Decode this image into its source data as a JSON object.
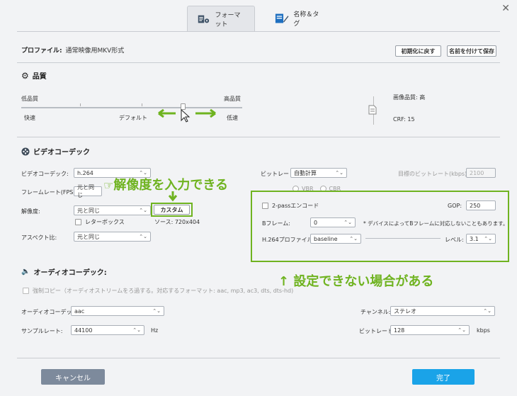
{
  "tabs": [
    {
      "label": "フォーマット",
      "icon": "format-settings-icon"
    },
    {
      "label": "名称＆タグ",
      "icon": "edit-tag-icon"
    }
  ],
  "profile": {
    "label": "プロファイル:",
    "value": "通常映像用MKV形式"
  },
  "buttons": {
    "reset": "初期化に戻す",
    "save_as": "名前を付けて保存",
    "cancel": "キャンセル",
    "ok": "完了"
  },
  "quality": {
    "title": "品質",
    "low": "低品質",
    "high": "高品質",
    "fast": "快速",
    "default": "デフォルト",
    "slow": "低速",
    "image_quality": "画像品質: 高",
    "crf": "CRF: 15"
  },
  "video": {
    "title": "ビデオコーデック",
    "codec_label": "ビデオコーデック:",
    "codec_value": "h.264",
    "fps_label": "フレームレート(FPS):",
    "fps_value": "元と同じ",
    "resolution_label": "解像度:",
    "resolution_value": "元と同じ",
    "custom_button": "カスタム",
    "letterbox": "レターボックス",
    "source": "ソース: 720x404",
    "aspect_label": "アスペクト比:",
    "aspect_value": "元と同じ",
    "bitrate_label": "ビットレート:",
    "bitrate_value": "自動計算",
    "target_bitrate_label": "目標のビットレート(kbps):",
    "target_bitrate_value": "2100",
    "vbr": "VBR",
    "cbr": "CBR",
    "twopass": "2-passエンコード",
    "gop_label": "GOP:",
    "gop_value": "250",
    "bframe_label": "Bフレーム:",
    "bframe_value": "0",
    "bframe_note": "* デバイスによってBフレームに対応しないこともあります。",
    "profile_label": "H.264プロファイル:",
    "profile_value": "baseline",
    "level_label": "レベル:",
    "level_value": "3.1"
  },
  "audio": {
    "title": "オーディオコーデック:",
    "force_copy": "強制コピー（オーディオストリームをろ過する。対応するフォーマット: aac, mp3, ac3, dts, dts-hd)",
    "codec_label": "オーディオコーデック:",
    "codec_value": "aac",
    "channel_label": "チャンネル:",
    "channel_value": "ステレオ",
    "samplerate_label": "サンプルレート:",
    "samplerate_value": "44100",
    "samplerate_unit": "Hz",
    "bitrate_label": "ビットレート:",
    "bitrate_value": "128",
    "bitrate_unit": "kbps"
  },
  "annotations": {
    "resolution_tip": "解像度を入力できる",
    "cannot_set_tip": "↑ 設定できない場合がある"
  },
  "colors": {
    "accent_green": "#6fb320",
    "ok_button": "#1aa3e8",
    "cancel_button": "#7d8a9c"
  }
}
